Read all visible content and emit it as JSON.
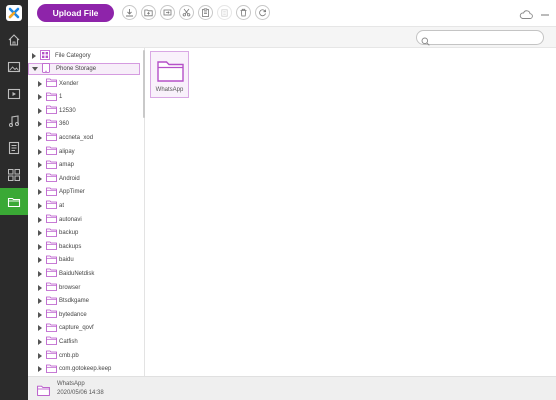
{
  "colors": {
    "accent": "#8e24aa",
    "rail_bg": "#2b2b2b",
    "active_nav": "#3aa935",
    "folder": "#b550c8"
  },
  "toolbar": {
    "upload_label": "Upload File",
    "buttons": [
      "download-icon",
      "new-folder-icon",
      "export-icon",
      "cut-icon",
      "paste-icon",
      "delete-icon",
      "trash-icon",
      "refresh-icon"
    ]
  },
  "rail": {
    "items": [
      "home-icon",
      "photos-icon",
      "videos-icon",
      "music-icon",
      "documents-icon",
      "apps-icon",
      "files-icon"
    ],
    "active": "files-icon"
  },
  "search": {
    "placeholder": ""
  },
  "tree": {
    "root_items": [
      {
        "label": "File Category",
        "icon": "category-icon"
      },
      {
        "label": "Phone Storage",
        "icon": "phone-icon",
        "selected": true
      }
    ],
    "folders": [
      "Xender",
      "1",
      "12530",
      "360",
      "accneta_xod",
      "alipay",
      "amap",
      "Android",
      "AppTimer",
      "at",
      "autonavi",
      "backup",
      "backups",
      "baidu",
      "BaiduNetdisk",
      "browser",
      "Btsdkgame",
      "bytedance",
      "capture_qovf",
      "Catfish",
      "cmb.pb",
      "com.gotokeep.keep"
    ]
  },
  "content": {
    "items": [
      {
        "name": "WhatsApp"
      }
    ]
  },
  "status": {
    "name": "WhatsApp",
    "date": "2020/05/06 14:38"
  }
}
